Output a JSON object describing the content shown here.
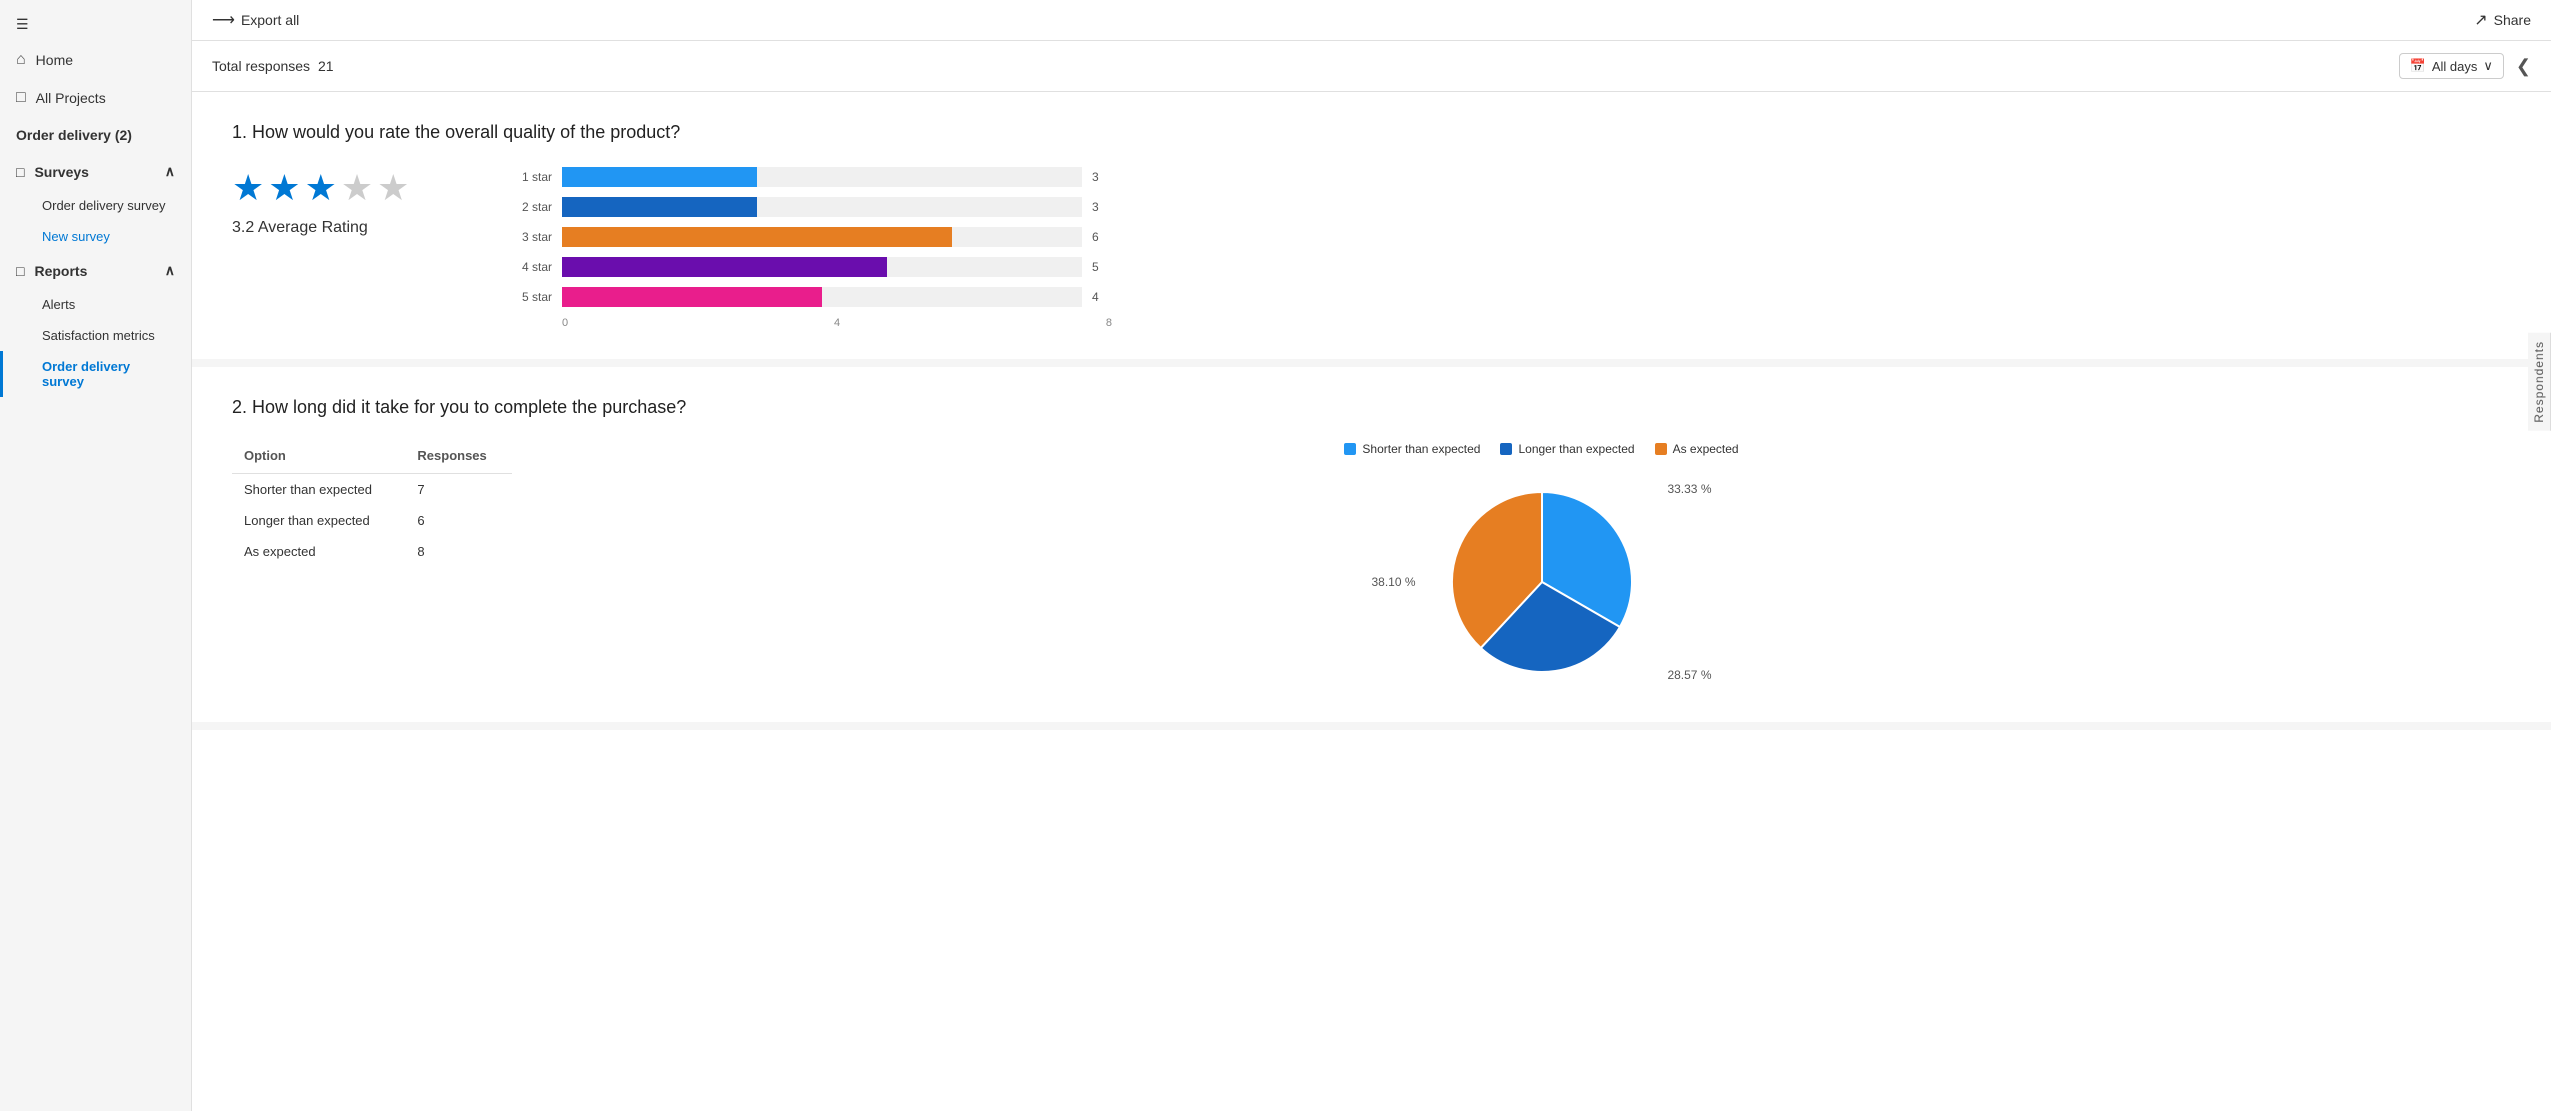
{
  "sidebar": {
    "menu_icon": "☰",
    "nav_items": [
      {
        "id": "home",
        "label": "Home",
        "icon": "⌂"
      },
      {
        "id": "all-projects",
        "label": "All Projects",
        "icon": "□"
      }
    ],
    "section_title": "Order delivery (2)",
    "surveys_label": "Surveys",
    "surveys_icon": "□",
    "survey_items": [
      {
        "id": "order-delivery-survey",
        "label": "Order delivery survey",
        "active": false
      },
      {
        "id": "new-survey",
        "label": "New survey",
        "active": false,
        "is_new": true
      }
    ],
    "reports_label": "Reports",
    "reports_icon": "□",
    "report_items": [
      {
        "id": "alerts",
        "label": "Alerts",
        "active": false
      },
      {
        "id": "satisfaction-metrics",
        "label": "Satisfaction metrics",
        "active": false
      },
      {
        "id": "order-delivery-survey-report",
        "label": "Order delivery survey",
        "active": true
      }
    ]
  },
  "toolbar": {
    "export_label": "Export all",
    "share_label": "Share"
  },
  "summary": {
    "total_responses_label": "Total responses",
    "total_responses_count": "21",
    "days_filter_label": "All days",
    "collapse_icon": "❮"
  },
  "questions": [
    {
      "id": "q1",
      "number": "1",
      "text": "How would you rate the overall quality of the product?",
      "type": "rating",
      "average_rating": "3.2",
      "average_label": "Average Rating",
      "stars_filled": 3,
      "stars_empty": 2,
      "bars": [
        {
          "label": "1 star",
          "value": 3,
          "max": 8,
          "color": "#2196F3"
        },
        {
          "label": "2 star",
          "value": 3,
          "max": 8,
          "color": "#1565C0"
        },
        {
          "label": "3 star",
          "value": 6,
          "max": 8,
          "color": "#E67E22"
        },
        {
          "label": "4 star",
          "value": 5,
          "max": 8,
          "color": "#6A0DAD"
        },
        {
          "label": "5 star",
          "value": 4,
          "max": 8,
          "color": "#E91E8C"
        }
      ],
      "axis_labels": [
        "0",
        "4",
        "8"
      ]
    },
    {
      "id": "q2",
      "number": "2",
      "text": "How long did it take for you to complete the purchase?",
      "type": "multiple_choice",
      "table_headers": [
        "Option",
        "Responses"
      ],
      "options": [
        {
          "label": "Shorter than expected",
          "value": 7,
          "percent": "33.33",
          "color": "#2196F3"
        },
        {
          "label": "Longer than expected",
          "value": 6,
          "percent": "28.57",
          "color": "#1565C0"
        },
        {
          "label": "As expected",
          "value": 8,
          "percent": "38.10",
          "color": "#E67E22"
        }
      ],
      "legend": [
        {
          "label": "Shorter than expected",
          "color": "#2196F3"
        },
        {
          "label": "Longer than expected",
          "color": "#1565C0"
        },
        {
          "label": "As expected",
          "color": "#E67E22"
        }
      ]
    }
  ],
  "respondents_tab": "Respondents"
}
